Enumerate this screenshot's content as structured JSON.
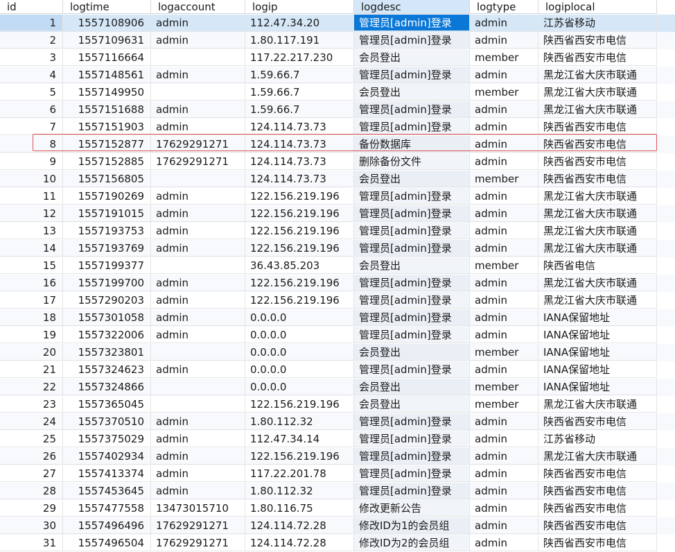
{
  "columns": [
    "id",
    "logtime",
    "logaccount",
    "logip",
    "logdesc",
    "logtype",
    "logiplocal"
  ],
  "rows": [
    {
      "id": "1",
      "logtime": "1557108906",
      "logaccount": "admin",
      "logip": "112.47.34.20",
      "logdesc": "管理员[admin]登录",
      "logtype": "admin",
      "logiplocal": "江苏省移动"
    },
    {
      "id": "2",
      "logtime": "1557109631",
      "logaccount": "admin",
      "logip": "1.80.117.191",
      "logdesc": "管理员[admin]登录",
      "logtype": "admin",
      "logiplocal": "陕西省西安市电信"
    },
    {
      "id": "3",
      "logtime": "1557116664",
      "logaccount": "",
      "logip": "117.22.217.230",
      "logdesc": "会员登出",
      "logtype": "member",
      "logiplocal": "陕西省西安市电信"
    },
    {
      "id": "4",
      "logtime": "1557148561",
      "logaccount": "admin",
      "logip": "1.59.66.7",
      "logdesc": "管理员[admin]登录",
      "logtype": "admin",
      "logiplocal": "黑龙江省大庆市联通"
    },
    {
      "id": "5",
      "logtime": "1557149950",
      "logaccount": "",
      "logip": "1.59.66.7",
      "logdesc": "会员登出",
      "logtype": "member",
      "logiplocal": "黑龙江省大庆市联通"
    },
    {
      "id": "6",
      "logtime": "1557151688",
      "logaccount": "admin",
      "logip": "1.59.66.7",
      "logdesc": "管理员[admin]登录",
      "logtype": "admin",
      "logiplocal": "黑龙江省大庆市联通"
    },
    {
      "id": "7",
      "logtime": "1557151903",
      "logaccount": "admin",
      "logip": "124.114.73.73",
      "logdesc": "管理员[admin]登录",
      "logtype": "admin",
      "logiplocal": "陕西省西安市电信"
    },
    {
      "id": "8",
      "logtime": "1557152877",
      "logaccount": "17629291271",
      "logip": "124.114.73.73",
      "logdesc": "备份数据库",
      "logtype": "admin",
      "logiplocal": "陕西省西安市电信"
    },
    {
      "id": "9",
      "logtime": "1557152885",
      "logaccount": "17629291271",
      "logip": "124.114.73.73",
      "logdesc": "删除备份文件",
      "logtype": "admin",
      "logiplocal": "陕西省西安市电信"
    },
    {
      "id": "10",
      "logtime": "1557156805",
      "logaccount": "",
      "logip": "124.114.73.73",
      "logdesc": "会员登出",
      "logtype": "member",
      "logiplocal": "陕西省西安市电信"
    },
    {
      "id": "11",
      "logtime": "1557190269",
      "logaccount": "admin",
      "logip": "122.156.219.196",
      "logdesc": "管理员[admin]登录",
      "logtype": "admin",
      "logiplocal": "黑龙江省大庆市联通"
    },
    {
      "id": "12",
      "logtime": "1557191015",
      "logaccount": "admin",
      "logip": "122.156.219.196",
      "logdesc": "管理员[admin]登录",
      "logtype": "admin",
      "logiplocal": "黑龙江省大庆市联通"
    },
    {
      "id": "13",
      "logtime": "1557193753",
      "logaccount": "admin",
      "logip": "122.156.219.196",
      "logdesc": "管理员[admin]登录",
      "logtype": "admin",
      "logiplocal": "黑龙江省大庆市联通"
    },
    {
      "id": "14",
      "logtime": "1557193769",
      "logaccount": "admin",
      "logip": "122.156.219.196",
      "logdesc": "管理员[admin]登录",
      "logtype": "admin",
      "logiplocal": "黑龙江省大庆市联通"
    },
    {
      "id": "15",
      "logtime": "1557199377",
      "logaccount": "",
      "logip": "36.43.85.203",
      "logdesc": "会员登出",
      "logtype": "member",
      "logiplocal": "陕西省电信"
    },
    {
      "id": "16",
      "logtime": "1557199700",
      "logaccount": "admin",
      "logip": "122.156.219.196",
      "logdesc": "管理员[admin]登录",
      "logtype": "admin",
      "logiplocal": "黑龙江省大庆市联通"
    },
    {
      "id": "17",
      "logtime": "1557290203",
      "logaccount": "admin",
      "logip": "122.156.219.196",
      "logdesc": "管理员[admin]登录",
      "logtype": "admin",
      "logiplocal": "黑龙江省大庆市联通"
    },
    {
      "id": "18",
      "logtime": "1557301058",
      "logaccount": "admin",
      "logip": "0.0.0.0",
      "logdesc": "管理员[admin]登录",
      "logtype": "admin",
      "logiplocal": "IANA保留地址"
    },
    {
      "id": "19",
      "logtime": "1557322006",
      "logaccount": "admin",
      "logip": "0.0.0.0",
      "logdesc": "管理员[admin]登录",
      "logtype": "admin",
      "logiplocal": "IANA保留地址"
    },
    {
      "id": "20",
      "logtime": "1557323801",
      "logaccount": "",
      "logip": "0.0.0.0",
      "logdesc": "会员登出",
      "logtype": "member",
      "logiplocal": "IANA保留地址"
    },
    {
      "id": "21",
      "logtime": "1557324623",
      "logaccount": "admin",
      "logip": "0.0.0.0",
      "logdesc": "管理员[admin]登录",
      "logtype": "admin",
      "logiplocal": "IANA保留地址"
    },
    {
      "id": "22",
      "logtime": "1557324866",
      "logaccount": "",
      "logip": "0.0.0.0",
      "logdesc": "会员登出",
      "logtype": "member",
      "logiplocal": "IANA保留地址"
    },
    {
      "id": "23",
      "logtime": "1557365045",
      "logaccount": "",
      "logip": "122.156.219.196",
      "logdesc": "会员登出",
      "logtype": "member",
      "logiplocal": "黑龙江省大庆市联通"
    },
    {
      "id": "24",
      "logtime": "1557370510",
      "logaccount": "admin",
      "logip": "1.80.112.32",
      "logdesc": "管理员[admin]登录",
      "logtype": "admin",
      "logiplocal": "陕西省西安市电信"
    },
    {
      "id": "25",
      "logtime": "1557375029",
      "logaccount": "admin",
      "logip": "112.47.34.14",
      "logdesc": "管理员[admin]登录",
      "logtype": "admin",
      "logiplocal": "江苏省移动"
    },
    {
      "id": "26",
      "logtime": "1557402934",
      "logaccount": "admin",
      "logip": "122.156.219.196",
      "logdesc": "管理员[admin]登录",
      "logtype": "admin",
      "logiplocal": "黑龙江省大庆市联通"
    },
    {
      "id": "27",
      "logtime": "1557413374",
      "logaccount": "admin",
      "logip": "117.22.201.78",
      "logdesc": "管理员[admin]登录",
      "logtype": "admin",
      "logiplocal": "陕西省西安市电信"
    },
    {
      "id": "28",
      "logtime": "1557453645",
      "logaccount": "admin",
      "logip": "1.80.112.32",
      "logdesc": "管理员[admin]登录",
      "logtype": "admin",
      "logiplocal": "陕西省西安市电信"
    },
    {
      "id": "29",
      "logtime": "1557477558",
      "logaccount": "13473015710",
      "logip": "1.80.116.75",
      "logdesc": "修改更新公告",
      "logtype": "admin",
      "logiplocal": "陕西省西安市电信"
    },
    {
      "id": "30",
      "logtime": "1557496496",
      "logaccount": "17629291271",
      "logip": "124.114.72.28",
      "logdesc": "修改ID为1的会员组",
      "logtype": "admin",
      "logiplocal": "陕西省西安市电信"
    },
    {
      "id": "31",
      "logtime": "1557496504",
      "logaccount": "17629291271",
      "logip": "124.114.72.28",
      "logdesc": "修改ID为2的会员组",
      "logtype": "admin",
      "logiplocal": "陕西省西安市电信"
    }
  ],
  "selected_row_id": "1",
  "highlighted_row_id": "8",
  "colors": {
    "selection": "#0b78d7",
    "row_selected": "#d6e8f8",
    "highlight_box": "#e0565a"
  }
}
